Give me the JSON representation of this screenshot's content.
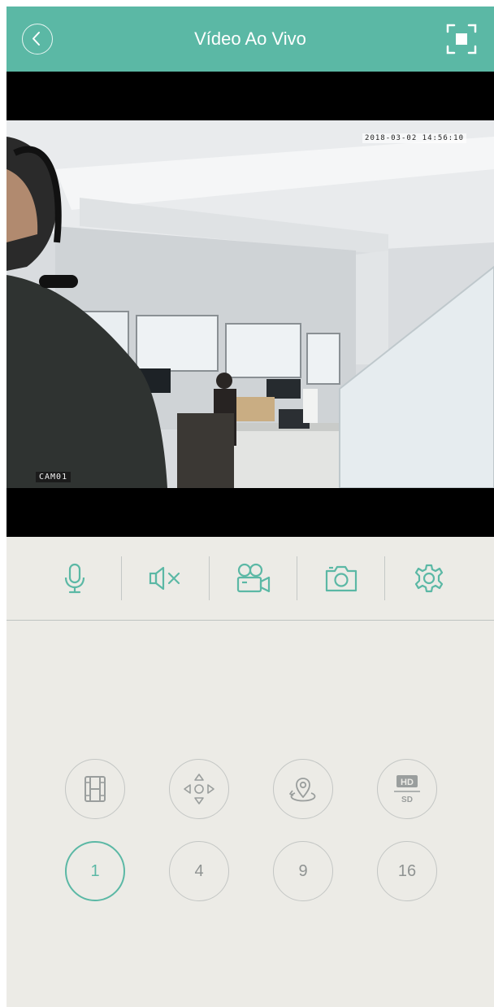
{
  "header": {
    "title": "Vídeo Ao Vivo",
    "back_icon": "chevron-left-icon",
    "fullscreen_icon": "fullscreen-icon",
    "background": "#5bb8a5"
  },
  "video": {
    "timestamp": "2018-03-02 14:56:10",
    "camera_label": "CAM01"
  },
  "toolbar": {
    "items": [
      {
        "icon": "microphone-icon"
      },
      {
        "icon": "speaker-muted-icon"
      },
      {
        "icon": "video-record-icon"
      },
      {
        "icon": "camera-snapshot-icon"
      },
      {
        "icon": "settings-gear-icon"
      }
    ],
    "accent": "#5bb8a5"
  },
  "controls": {
    "row1": [
      {
        "icon": "film-playback-icon"
      },
      {
        "icon": "ptz-direction-icon"
      },
      {
        "icon": "location-pin-icon"
      },
      {
        "icon": "hd-sd-toggle-icon",
        "hd_label": "HD",
        "sd_label": "SD"
      }
    ],
    "layout_options": [
      "1",
      "4",
      "9",
      "16"
    ],
    "selected_layout": "1"
  }
}
